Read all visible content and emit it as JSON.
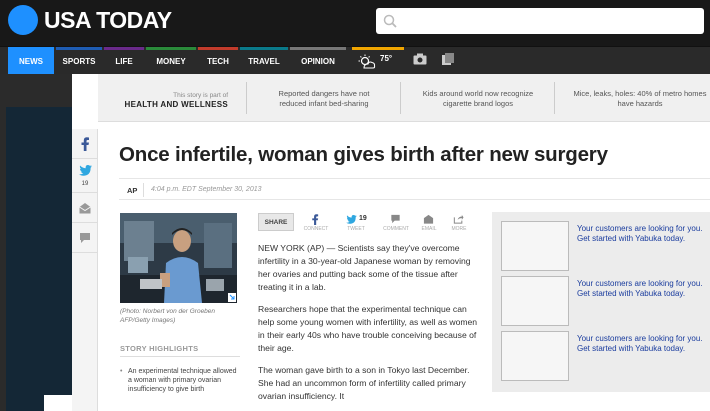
{
  "header": {
    "logo_text": "USA TODAY",
    "search_placeholder": ""
  },
  "nav": {
    "items": [
      {
        "label": "NEWS",
        "color": "#1e90ff"
      },
      {
        "label": "SPORTS",
        "color": "#1e5cb3"
      },
      {
        "label": "LIFE",
        "color": "#6a2a8a"
      },
      {
        "label": "MONEY",
        "color": "#2a8a3a"
      },
      {
        "label": "TECH",
        "color": "#c23b2b"
      },
      {
        "label": "TRAVEL",
        "color": "#0a7a8a"
      },
      {
        "label": "OPINION",
        "color": "#777777"
      }
    ],
    "weather_temp": "75°",
    "weather_icon": "partly-cloudy-icon",
    "camera_icon": "camera-icon",
    "media_icon": "media-icon"
  },
  "topbar": {
    "section_intro": "This story is part of",
    "section_name": "HEALTH AND WELLNESS",
    "stories": [
      "Reported dangers have not reduced infant bed-sharing",
      "Kids around world now recognize cigarette brand logos",
      "Mice, leaks, holes: 40% of metro homes have hazards"
    ]
  },
  "rail": {
    "twitter_count": "19"
  },
  "article": {
    "headline": "Once infertile, woman gives birth after new surgery",
    "author": "AP",
    "timestamp": "4:04 p.m. EDT September 30, 2013",
    "photo_caption": "(Photo: Norbert von der Groeben AFP/Getty Images)",
    "highlights_title": "STORY HIGHLIGHTS",
    "highlights": [
      "An experimental technique allowed a woman with primary ovarian insufficiency to give birth"
    ],
    "share": {
      "label": "SHARE",
      "connect": "CONNECT",
      "tweet": "TWEET",
      "tweet_count": "19",
      "comment": "COMMENT",
      "email": "EMAIL",
      "more": "MORE"
    },
    "paragraphs": [
      "NEW YORK (AP) — Scientists say they've overcome infertility in a 30-year-old Japanese woman by removing her ovaries and putting back some of the tissue after treating it in a lab.",
      "Researchers hope that the experimental technique can help some young women with infertility, as well as women in their early 40s who have trouble conceiving because of their age.",
      "The woman gave birth to a son in Tokyo last December. She had an uncommon form of infertility called primary ovarian insufficiency. It"
    ]
  },
  "ads": [
    "Your customers are looking for you. Get started with Yabuka today.",
    "Your customers are looking for you. Get started with Yabuka today.",
    "Your customers are looking for you. Get started with Yabuka today."
  ]
}
